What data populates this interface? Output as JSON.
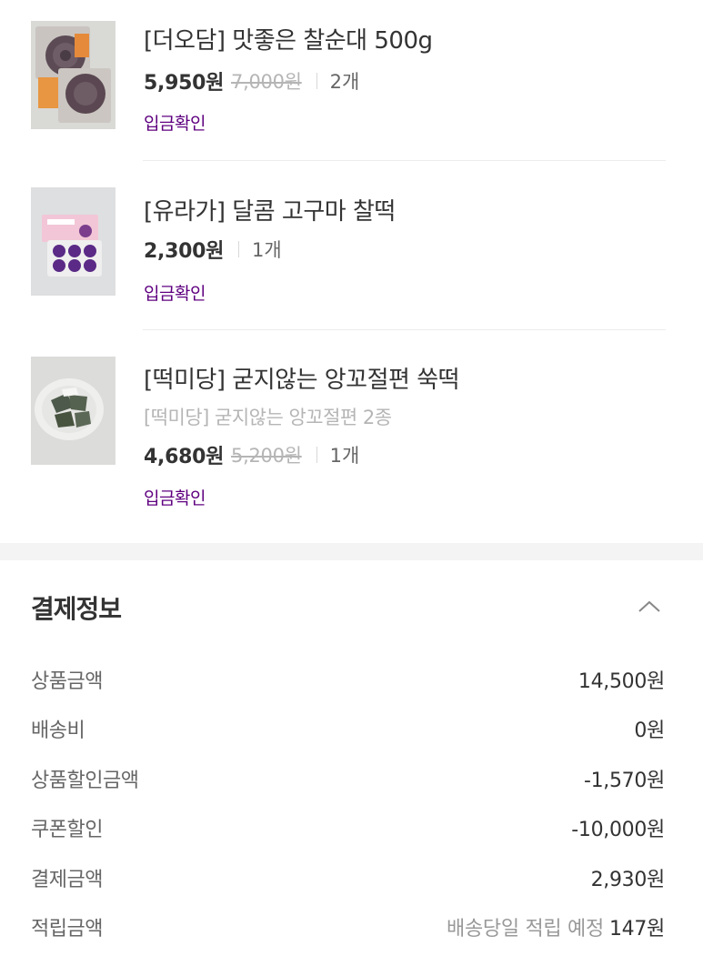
{
  "items": [
    {
      "name": "[더오담] 맛좋은 찰순대 500g",
      "option": "",
      "price": "5,950원",
      "original_price": "7,000원",
      "quantity": "2개",
      "status": "입금확인",
      "thumb_icon": "sundae-product-image"
    },
    {
      "name": "[유라가] 달콤 고구마 찰떡",
      "option": "",
      "price": "2,300원",
      "original_price": "",
      "quantity": "1개",
      "status": "입금확인",
      "thumb_icon": "sweet-potato-rice-cake-image"
    },
    {
      "name": "[떡미당] 굳지않는 앙꼬절편 쑥떡",
      "option": "[떡미당] 굳지않는 앙꼬절편 2종",
      "price": "4,680원",
      "original_price": "5,200원",
      "quantity": "1개",
      "status": "입금확인",
      "thumb_icon": "mugwort-rice-cake-image"
    }
  ],
  "payment": {
    "title": "결제정보",
    "toggle_icon": "chevron-up-icon",
    "rows": [
      {
        "label": "상품금액",
        "note": "",
        "value": "14,500원"
      },
      {
        "label": "배송비",
        "note": "",
        "value": "0원"
      },
      {
        "label": "상품할인금액",
        "note": "",
        "value": "-1,570원"
      },
      {
        "label": "쿠폰할인",
        "note": "",
        "value": "-10,000원"
      },
      {
        "label": "결제금액",
        "note": "",
        "value": "2,930원"
      },
      {
        "label": "적립금액",
        "note": "배송당일 적립 예정",
        "value": "147원"
      }
    ]
  },
  "colors": {
    "status_purple": "#5f0080",
    "section_gap": "#f4f4f4",
    "muted_text": "#b5b5b5"
  }
}
